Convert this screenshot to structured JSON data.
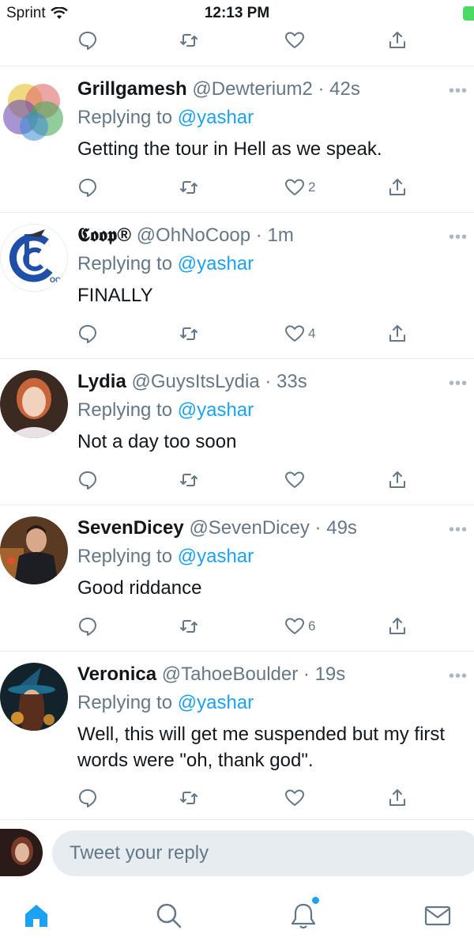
{
  "status_bar": {
    "carrier": "Sprint",
    "time": "12:13 PM"
  },
  "tweets": [
    {
      "name": "Grillgamesh",
      "handle": "@Dewterium2",
      "separator": "·",
      "time": "42s",
      "replying_prefix": "Replying to",
      "replying_to": "@yashar",
      "text": "Getting the tour in Hell as we speak.",
      "like_count": "2",
      "avatar": "venn-diagram-avatar"
    },
    {
      "name": "𝕮𝖔𝖔𝖕®",
      "handle": "@OhNoCoop",
      "separator": "·",
      "time": "1m",
      "replying_prefix": "Replying to",
      "replying_to": "@yashar",
      "text": "FINALLY",
      "like_count": "4",
      "avatar": "coop-logo-avatar",
      "avatar_text": "OOP"
    },
    {
      "name": "Lydia",
      "handle": "@GuysItsLydia",
      "separator": "·",
      "time": "33s",
      "replying_prefix": "Replying to",
      "replying_to": "@yashar",
      "text": "Not a day too soon",
      "like_count": "",
      "avatar": "portrait-avatar"
    },
    {
      "name": "SevenDicey",
      "handle": "@SevenDicey",
      "separator": "·",
      "time": "49s",
      "replying_prefix": "Replying to",
      "replying_to": "@yashar",
      "text": "Good riddance",
      "like_count": "6",
      "avatar": "portrait-avatar"
    },
    {
      "name": "Veronica",
      "handle": "@TahoeBoulder",
      "separator": "·",
      "time": "19s",
      "replying_prefix": "Replying to",
      "replying_to": "@yashar",
      "text": "Well, this will get me suspended but my first words were \"oh, thank god\".",
      "like_count": "",
      "avatar": "witch-avatar"
    }
  ],
  "composer": {
    "placeholder": "Tweet your reply"
  },
  "colors": {
    "accent": "#1da1f2",
    "text_secondary": "#657786",
    "divider": "#e6ecf0",
    "battery": "#4cd964"
  },
  "tab_bar": {
    "icons": [
      "home-icon",
      "search-icon",
      "notifications-icon",
      "messages-icon"
    ]
  }
}
